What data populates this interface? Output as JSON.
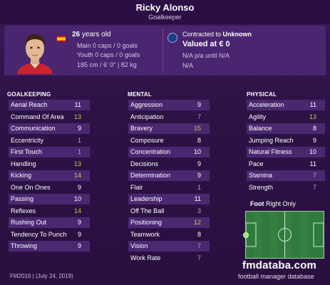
{
  "header": {
    "name": "Ricky Alonso",
    "position": "Goalkeeper"
  },
  "info": {
    "age_number": "26",
    "age_suffix": " years old",
    "main_caps": "Main 0 caps / 0 goals",
    "youth_caps": "Youth 0 caps / 0 goals",
    "physical": "185 cm / 6' 0\" | 82 kg",
    "contract_prefix": "Contracted to ",
    "contract_club": "Unknown",
    "value": "Valued at € 0",
    "wage": "N/A p/a until N/A",
    "extra": "N/A"
  },
  "sections": {
    "goalkeeping": "GOALKEEPING",
    "mental": "MENTAL",
    "physical": "PHYSICAL"
  },
  "goalkeeping": [
    {
      "label": "Aerial Reach",
      "value": "11",
      "tone": "w"
    },
    {
      "label": "Command Of Area",
      "value": "13",
      "tone": "g"
    },
    {
      "label": "Communication",
      "value": "9",
      "tone": "w"
    },
    {
      "label": "Eccentricity",
      "value": "1",
      "tone": "l"
    },
    {
      "label": "First Touch",
      "value": "1",
      "tone": "l"
    },
    {
      "label": "Handling",
      "value": "13",
      "tone": "g"
    },
    {
      "label": "Kicking",
      "value": "14",
      "tone": "g"
    },
    {
      "label": "One On Ones",
      "value": "9",
      "tone": "w"
    },
    {
      "label": "Passing",
      "value": "10",
      "tone": "w"
    },
    {
      "label": "Reflexes",
      "value": "14",
      "tone": "g"
    },
    {
      "label": "Rushing Out",
      "value": "9",
      "tone": "w"
    },
    {
      "label": "Tendency To Punch",
      "value": "9",
      "tone": "w"
    },
    {
      "label": "Throwing",
      "value": "9",
      "tone": "w"
    }
  ],
  "mental": [
    {
      "label": "Aggression",
      "value": "9",
      "tone": "w"
    },
    {
      "label": "Anticipation",
      "value": "7",
      "tone": "l"
    },
    {
      "label": "Bravery",
      "value": "15",
      "tone": "g"
    },
    {
      "label": "Composure",
      "value": "8",
      "tone": "w"
    },
    {
      "label": "Concentration",
      "value": "10",
      "tone": "w"
    },
    {
      "label": "Decisions",
      "value": "9",
      "tone": "w"
    },
    {
      "label": "Determination",
      "value": "9",
      "tone": "w"
    },
    {
      "label": "Flair",
      "value": "1",
      "tone": "l"
    },
    {
      "label": "Leadership",
      "value": "11",
      "tone": "w"
    },
    {
      "label": "Off The Ball",
      "value": "3",
      "tone": "l"
    },
    {
      "label": "Positioning",
      "value": "12",
      "tone": "g"
    },
    {
      "label": "Teamwork",
      "value": "8",
      "tone": "w"
    },
    {
      "label": "Vision",
      "value": "7",
      "tone": "l"
    },
    {
      "label": "Work Rate",
      "value": "7",
      "tone": "l"
    }
  ],
  "physical": [
    {
      "label": "Acceleration",
      "value": "11",
      "tone": "w"
    },
    {
      "label": "Agility",
      "value": "13",
      "tone": "g"
    },
    {
      "label": "Balance",
      "value": "8",
      "tone": "w"
    },
    {
      "label": "Jumping Reach",
      "value": "9",
      "tone": "w"
    },
    {
      "label": "Natural Fitness",
      "value": "10",
      "tone": "w"
    },
    {
      "label": "Pace",
      "value": "11",
      "tone": "w"
    },
    {
      "label": "Stamina",
      "value": "7",
      "tone": "l"
    },
    {
      "label": "Strength",
      "value": "7",
      "tone": "l"
    }
  ],
  "foot": {
    "label": "Foot",
    "value": "Right Only"
  },
  "footer": {
    "version": "FM2019 | (July 24, 2019)",
    "brand": "fmdataba.com",
    "brand_sub": "football manager database"
  },
  "colors": {
    "background": "#2a1240",
    "row_band": "#4a2870",
    "good_value": "#b9d04a",
    "low_value": "#b0a4c4",
    "pitch": "#2f7a3c"
  }
}
